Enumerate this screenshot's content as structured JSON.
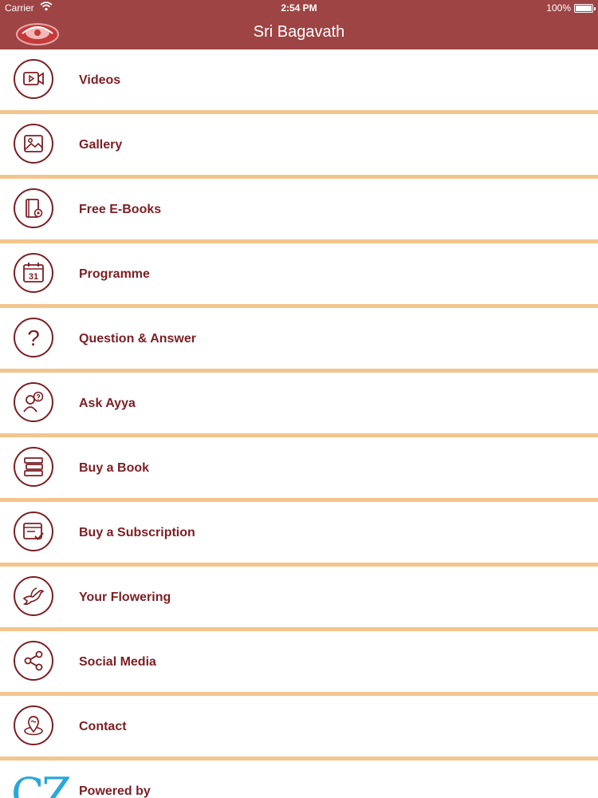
{
  "status": {
    "carrier": "Carrier",
    "time": "2:54 PM",
    "battery": "100%"
  },
  "navbar": {
    "title": "Sri Bagavath"
  },
  "menu": [
    {
      "label": "Videos",
      "icon": "video-icon"
    },
    {
      "label": "Gallery",
      "icon": "image-icon"
    },
    {
      "label": "Free E-Books",
      "icon": "ebook-icon"
    },
    {
      "label": "Programme",
      "icon": "calendar-icon"
    },
    {
      "label": "Question & Answer",
      "icon": "question-icon"
    },
    {
      "label": "Ask Ayya",
      "icon": "ask-person-icon"
    },
    {
      "label": "Buy a Book",
      "icon": "books-icon"
    },
    {
      "label": "Buy a Subscription",
      "icon": "subscription-icon"
    },
    {
      "label": "Your Flowering",
      "icon": "dove-icon"
    },
    {
      "label": "Social Media",
      "icon": "share-icon"
    },
    {
      "label": "Contact",
      "icon": "location-icon"
    }
  ],
  "calendar_day": "31",
  "question_mark": "?",
  "powered": {
    "label": "Powered by",
    "logo_text": "CZ"
  },
  "colors": {
    "bar": "#9e4444",
    "accent": "#7b1f24",
    "divider": "#f3c58e",
    "logo": "#29a8d9"
  }
}
